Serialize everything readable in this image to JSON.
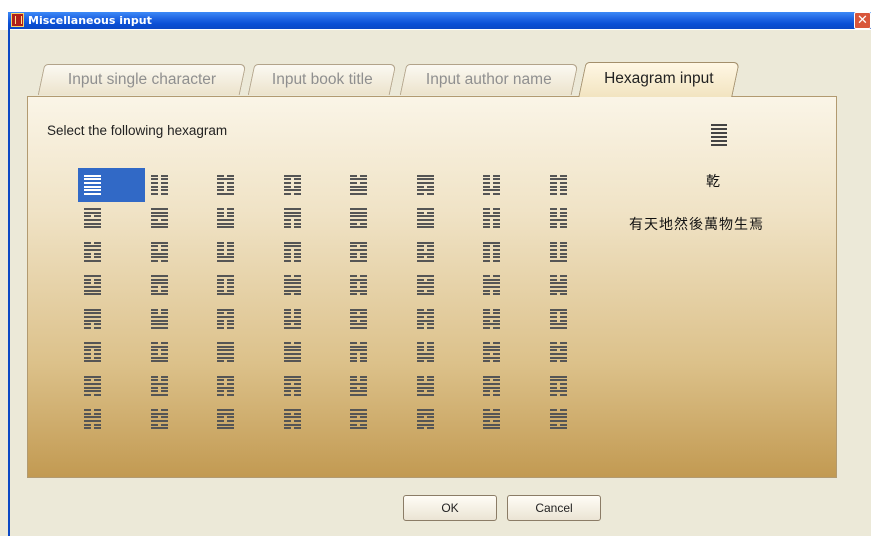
{
  "window": {
    "title": "Miscellaneous input",
    "close_glyph": "✕"
  },
  "tabs": [
    {
      "label": "Input single character",
      "active": false
    },
    {
      "label": "Input book title",
      "active": false
    },
    {
      "label": "Input author name",
      "active": false
    },
    {
      "label": "Hexagram input",
      "active": true
    }
  ],
  "panel": {
    "prompt": "Select the following hexagram",
    "selected_index": 0,
    "hexagram_name": "乾",
    "hexagram_text": "有天地然後萬物生焉"
  },
  "buttons": {
    "ok": "OK",
    "cancel": "Cancel"
  },
  "colors": {
    "selection": "#3169c6",
    "titlebar": "#0b48c4"
  }
}
